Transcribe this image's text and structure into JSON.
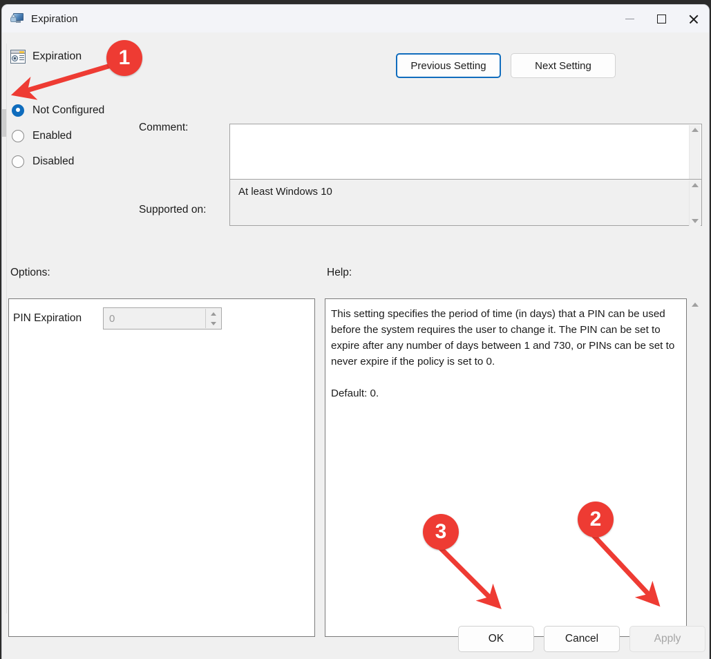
{
  "window": {
    "title": "Expiration",
    "icon": "computer-user-icon",
    "controls": {
      "minimize": "minimize-icon",
      "maximize": "maximize-icon",
      "close": "close-icon"
    }
  },
  "header": {
    "policy_icon": "policy-setting-icon",
    "policy_name": "Expiration",
    "previous_setting_label": "Previous Setting",
    "next_setting_label": "Next Setting"
  },
  "state_options": [
    {
      "label": "Not Configured",
      "checked": true
    },
    {
      "label": "Enabled",
      "checked": false
    },
    {
      "label": "Disabled",
      "checked": false
    }
  ],
  "comment": {
    "label": "Comment:",
    "value": "",
    "placeholder": ""
  },
  "supported_on": {
    "label": "Supported on:",
    "value": "At least Windows 10"
  },
  "options": {
    "label": "Options:",
    "pin_expiration_label": "PIN Expiration",
    "pin_expiration_value": "0",
    "pin_expiration_disabled": true
  },
  "help": {
    "label": "Help:",
    "text": "This setting specifies the period of time (in days) that a PIN can be used before the system requires the user to change it. The PIN can be set to expire after any number of days between 1 and 730, or PINs can be set to never expire if the policy is set to 0.\n\nDefault: 0."
  },
  "footer": {
    "ok_label": "OK",
    "cancel_label": "Cancel",
    "apply_label": "Apply",
    "apply_disabled": true
  },
  "annotations": [
    {
      "number": "1",
      "target": "not-configured-radio"
    },
    {
      "number": "2",
      "target": "apply-button"
    },
    {
      "number": "3",
      "target": "ok-button"
    }
  ],
  "colors": {
    "accent": "#0f6cbd",
    "annotation": "#ee3b33",
    "window_bg": "#f0f0f0",
    "titlebar_bg": "#f3f4f8"
  }
}
